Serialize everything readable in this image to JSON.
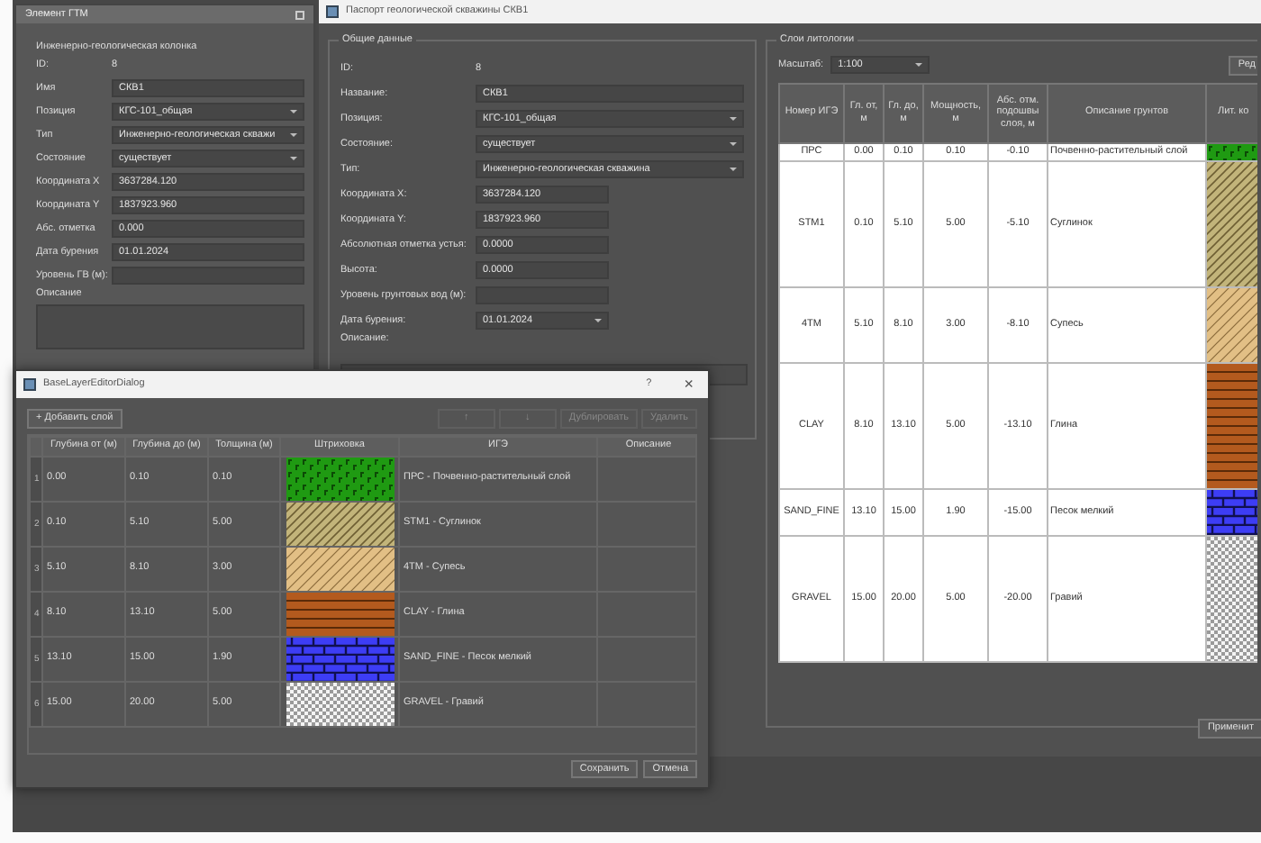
{
  "dock": {
    "title": "Элемент ГТМ",
    "subtitle": "Инженерно-геологическая колонка",
    "fields": [
      {
        "label": "ID:",
        "value": "8",
        "kind": "plain"
      },
      {
        "label": "Имя",
        "value": "СКВ1",
        "kind": "text"
      },
      {
        "label": "Позиция",
        "value": "КГС-101_общая",
        "kind": "combo"
      },
      {
        "label": "Тип",
        "value": "Инженерно-геологическая скважи",
        "kind": "combo"
      },
      {
        "label": "Состояние",
        "value": "существует",
        "kind": "combo"
      },
      {
        "label": "Координата X",
        "value": "3637284.120",
        "kind": "text"
      },
      {
        "label": "Координата Y",
        "value": "1837923.960",
        "kind": "text"
      },
      {
        "label": "Абс. отметка",
        "value": "0.000",
        "kind": "text"
      },
      {
        "label": "Дата бурения",
        "value": "01.01.2024",
        "kind": "text"
      },
      {
        "label": "Уровень ГВ (м):",
        "kind": "text"
      },
      {
        "label": "Описание",
        "kind": "textarea"
      }
    ]
  },
  "main_window": {
    "title": "Паспорт геологической скважины СКВ1",
    "general": {
      "title": "Общие данные",
      "fields": [
        {
          "label": "ID:",
          "value": "8",
          "kind": "plain"
        },
        {
          "label": "Название:",
          "value": "СКВ1",
          "kind": "text"
        },
        {
          "label": "Позиция:",
          "value": "КГС-101_общая",
          "kind": "combo"
        },
        {
          "label": "Состояние:",
          "value": "существует",
          "kind": "combo"
        },
        {
          "label": "Тип:",
          "value": "Инженерно-геологическая скважина",
          "kind": "combo"
        },
        {
          "label": "Координата X:",
          "value": "3637284.120",
          "kind": "short"
        },
        {
          "label": "Координата Y:",
          "value": "1837923.960",
          "kind": "short"
        },
        {
          "label": "Абсолютная отметка устья:",
          "value": "0.0000",
          "kind": "short"
        },
        {
          "label": "Высота:",
          "value": "0.0000",
          "kind": "short"
        },
        {
          "label": "Уровень грунтовых вод (м):",
          "kind": "short"
        },
        {
          "label": "Дата бурения:",
          "value": "01.01.2024",
          "kind": "date"
        },
        {
          "label": "Описание:",
          "kind": "textarea"
        }
      ]
    },
    "layers": {
      "title": "Слои литологии",
      "scale_label": "Масштаб:",
      "scale_value": "1:100",
      "edit_button": "Ред",
      "columns": [
        "Номер ИГЭ",
        "Гл. от, м",
        "Гл. до, м",
        "Мощность, м",
        "Абс. отм. подошвы слоя, м",
        "Описание грунтов",
        "Лит. ко"
      ],
      "rows": [
        {
          "ige": "ПРС",
          "from": "0.00",
          "to": "0.10",
          "thickness": "0.10",
          "elevation": "-0.10",
          "description": "Почвенно-растительный слой",
          "kind": "grass"
        },
        {
          "ige": "STM1",
          "from": "0.10",
          "to": "5.10",
          "thickness": "5.00",
          "elevation": "-5.10",
          "description": "Суглинок",
          "kind": "loam"
        },
        {
          "ige": "4TM",
          "from": "5.10",
          "to": "8.10",
          "thickness": "3.00",
          "elevation": "-8.10",
          "description": "Супесь",
          "kind": "sandyloam"
        },
        {
          "ige": "CLAY",
          "from": "8.10",
          "to": "13.10",
          "thickness": "5.00",
          "elevation": "-13.10",
          "description": "Глина",
          "kind": "clay"
        },
        {
          "ige": "SAND_FINE",
          "from": "13.10",
          "to": "15.00",
          "thickness": "1.90",
          "elevation": "-15.00",
          "description": "Песок мелкий",
          "kind": "sand"
        },
        {
          "ige": "GRAVEL",
          "from": "15.00",
          "to": "20.00",
          "thickness": "5.00",
          "elevation": "-20.00",
          "description": "Гравий",
          "kind": "gravel"
        }
      ]
    },
    "apply_button": "Применит"
  },
  "dialog": {
    "title": "BaseLayerEditorDialog",
    "help": "?",
    "close": "×",
    "add_button": "+ Добавить слой",
    "toolbar_buttons": [
      {
        "label": "↑",
        "disabled": true
      },
      {
        "label": "↓",
        "disabled": true
      },
      {
        "label": "Дублировать",
        "disabled": true
      },
      {
        "label": "Удалить",
        "disabled": true
      }
    ],
    "columns": [
      "Глубина от (м)",
      "Глубина до (м)",
      "Толщина (м)",
      "Штриховка",
      "ИГЭ",
      "Описание"
    ],
    "rows": [
      {
        "number": "1",
        "from": "0.00",
        "to": "0.10",
        "thickness": "0.10",
        "kind": "grass",
        "ige": "ПРС - Почвенно-растительный слой"
      },
      {
        "number": "2",
        "from": "0.10",
        "to": "5.10",
        "thickness": "5.00",
        "kind": "loam",
        "ige": "STM1 - Суглинок"
      },
      {
        "number": "3",
        "from": "5.10",
        "to": "8.10",
        "thickness": "3.00",
        "kind": "sandyloam",
        "ige": "4TM - Супесь"
      },
      {
        "number": "4",
        "from": "8.10",
        "to": "13.10",
        "thickness": "5.00",
        "kind": "clay",
        "ige": "CLAY - Глина"
      },
      {
        "number": "5",
        "from": "13.10",
        "to": "15.00",
        "thickness": "1.90",
        "kind": "sand",
        "ige": "SAND_FINE - Песок мелкий"
      },
      {
        "number": "6",
        "from": "15.00",
        "to": "20.00",
        "thickness": "5.00",
        "kind": "gravel",
        "ige": "GRAVEL - Гравий"
      }
    ],
    "buttons": [
      "Сохранить",
      "Отмена"
    ]
  }
}
